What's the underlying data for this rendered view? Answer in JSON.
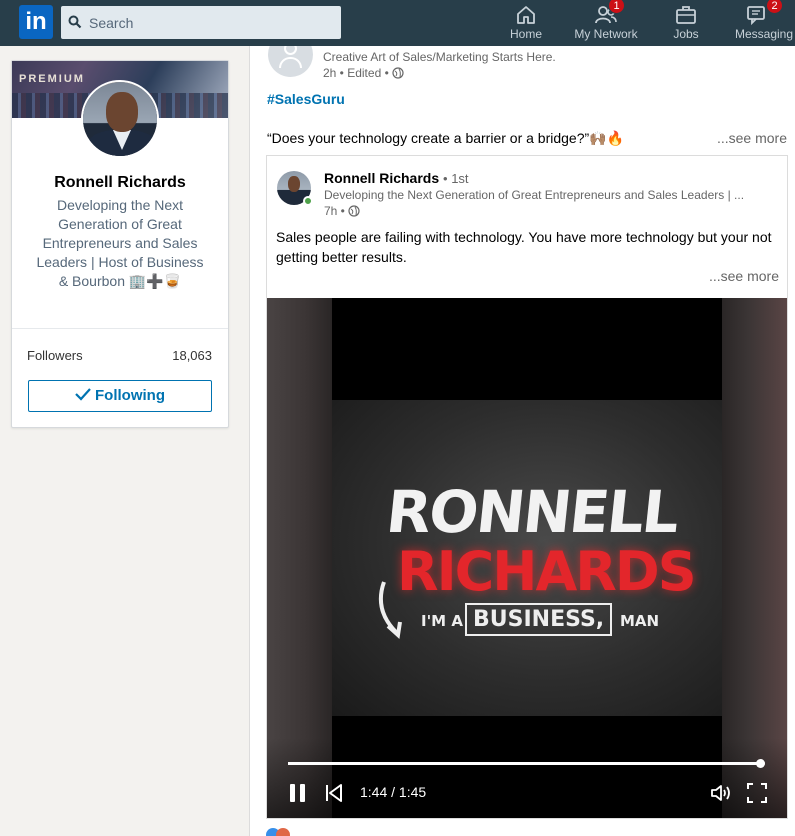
{
  "nav": {
    "search_placeholder": "Search",
    "items": [
      {
        "label": "Home",
        "icon": "home-icon"
      },
      {
        "label": "My Network",
        "icon": "network-icon",
        "badge": "1"
      },
      {
        "label": "Jobs",
        "icon": "jobs-icon"
      },
      {
        "label": "Messaging",
        "icon": "messaging-icon",
        "badge": "2"
      }
    ],
    "colors": {
      "bar": "#283e4a",
      "badge": "#cc1016",
      "accent": "#0073b1"
    }
  },
  "profile": {
    "premium_label": "PREMIUM",
    "name": "Ronnell Richards",
    "headline": "Developing the Next Generation of Great Entrepreneurs and Sales Leaders | Host of Business & Bourbon 🏢➕🥃",
    "followers_label": "Followers",
    "followers_count": "18,063",
    "following_button": "Following"
  },
  "post": {
    "author_description": "Creative Art of Sales/Marketing Starts Here.",
    "time": "2h • Edited •",
    "hashtag": "#SalesGuru",
    "text": "“Does your technology create a barrier or a bridge?”🙌🏽🔥",
    "see_more": "...see more",
    "shared": {
      "author_name": "Ronnell Richards",
      "degree": "• 1st",
      "headline": "Developing the Next Generation of Great Entrepreneurs and Sales Leaders | ...",
      "time": "7h •",
      "text": "Sales people are failing with technology. You have more technology but your not getting better results.",
      "see_more": "...see more",
      "video": {
        "line1": "RONNELL",
        "line2": "RICHARDS",
        "im_a": "I'M A",
        "business": "BUSINESS,",
        "man": "MAN",
        "time_display": "1:44 / 1:45",
        "progress": 0.99
      }
    }
  }
}
